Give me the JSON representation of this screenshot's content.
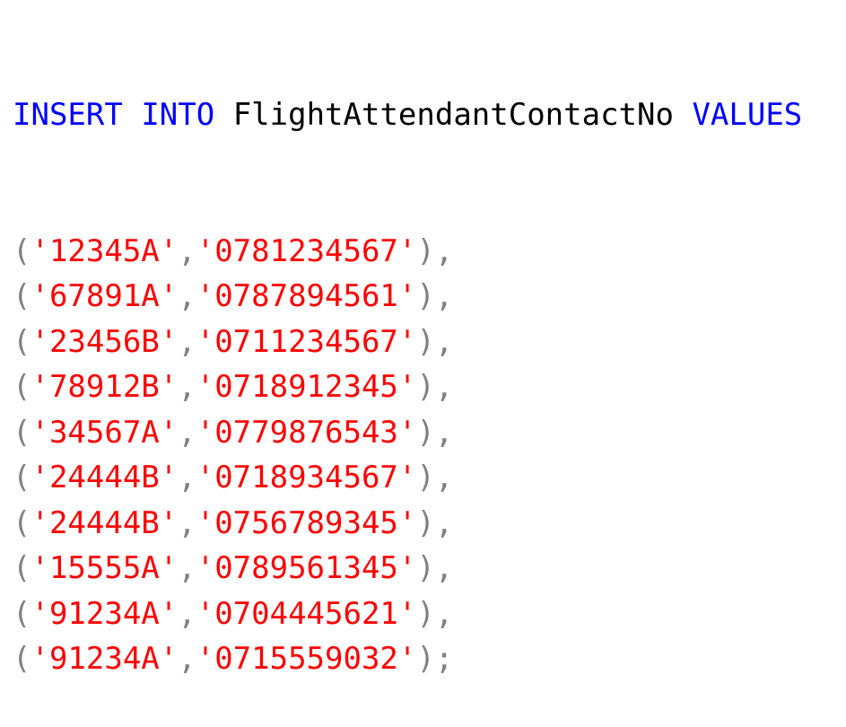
{
  "editor": {
    "statement": {
      "keyword_insert": "INSERT",
      "keyword_into": "INTO",
      "table_name": "FlightAttendantContactNo",
      "keyword_values": "VALUES"
    },
    "rows": [
      {
        "id": "'12345A'",
        "phone": "'0781234567'",
        "terminator": "),"
      },
      {
        "id": "'67891A'",
        "phone": "'0787894561'",
        "terminator": "),"
      },
      {
        "id": "'23456B'",
        "phone": "'0711234567'",
        "terminator": "),"
      },
      {
        "id": "'78912B'",
        "phone": "'0718912345'",
        "terminator": "),"
      },
      {
        "id": "'34567A'",
        "phone": "'0779876543'",
        "terminator": "),"
      },
      {
        "id": "'24444B'",
        "phone": "'0718934567'",
        "terminator": "),"
      },
      {
        "id": "'24444B'",
        "phone": "'0756789345'",
        "terminator": "),"
      },
      {
        "id": "'15555A'",
        "phone": "'0789561345'",
        "terminator": "),"
      },
      {
        "id": "'91234A'",
        "phone": "'0704445621'",
        "terminator": "),"
      },
      {
        "id": "'91234A'",
        "phone": "'0715559032'",
        "terminator": ");"
      }
    ],
    "open_paren": "(",
    "separator": ",",
    "colors": {
      "keyword": "#0000ff",
      "identifier": "#000000",
      "string": "#ff0000",
      "punctuation": "#808080"
    }
  }
}
